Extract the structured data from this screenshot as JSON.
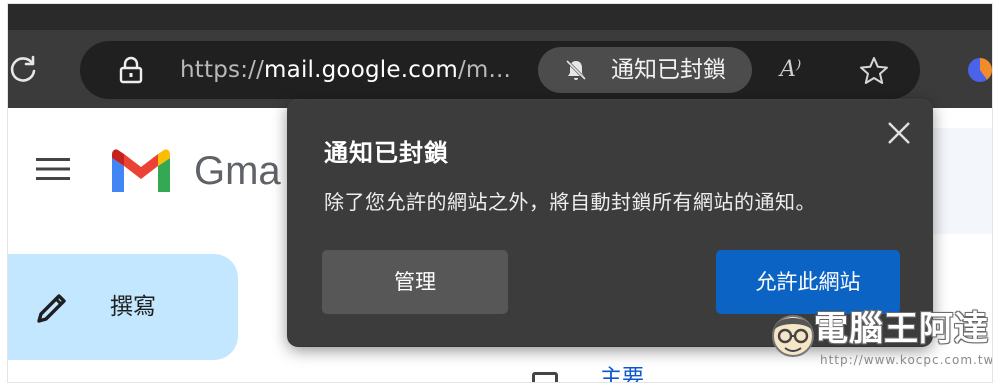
{
  "browser": {
    "url_prefix": "https://",
    "url_host": "mail.google.com",
    "url_suffix": "/m...",
    "notification_pill_text": "通知已封鎖",
    "read_aloud_glyph": "A⁾"
  },
  "gmail": {
    "logo_text": "Gma",
    "compose_label": "撰寫",
    "partial_tab": "主要"
  },
  "popup": {
    "title": "通知已封鎖",
    "description": "除了您允許的網站之外，將自動封鎖所有網站的通知。",
    "manage_button": "管理",
    "allow_button": "允許此網站"
  },
  "watermark": {
    "title": "電腦王阿達",
    "url": "http://www.kocpc.com.tw"
  },
  "colors": {
    "toolbar": "#3b3b3b",
    "addressbar": "#202020",
    "popup_bg": "#3c3c3c",
    "allow_button": "#0b63c4",
    "compose_bg": "#c2e7ff"
  }
}
